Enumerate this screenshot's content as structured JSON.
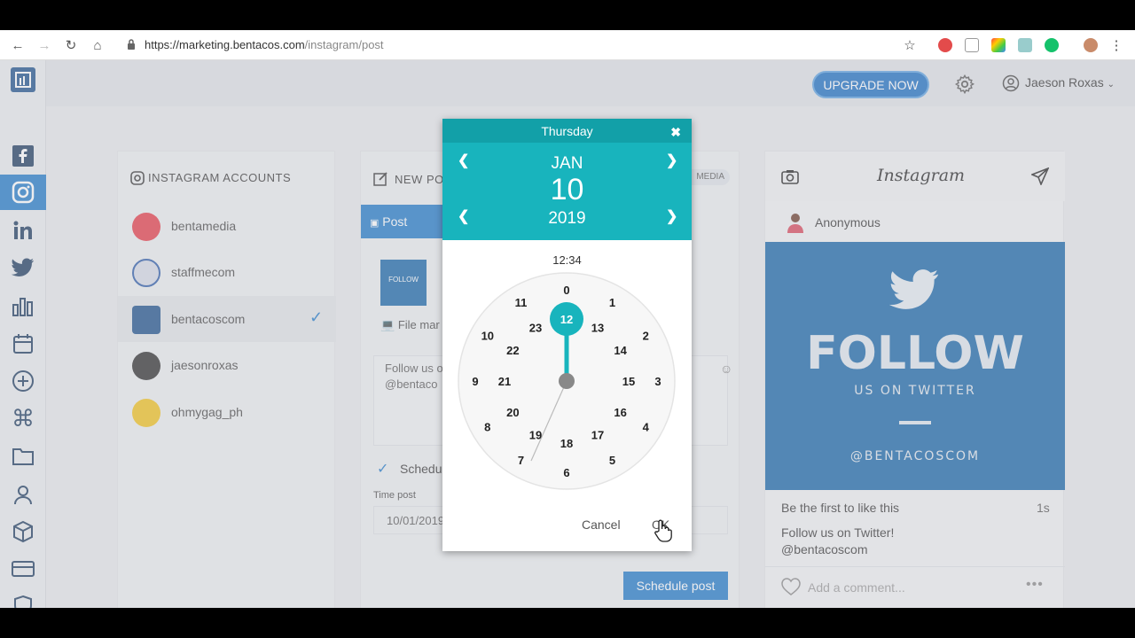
{
  "browser": {
    "url_host": "https://marketing.bentacos.com",
    "url_path": "/instagram/post"
  },
  "topbar": {
    "upgrade_label": "UPGRADE NOW",
    "user_name": "Jaeson Roxas"
  },
  "accounts": {
    "title": "INSTAGRAM ACCOUNTS",
    "items": [
      {
        "name": "bentamedia",
        "color": "#e53945"
      },
      {
        "name": "staffmecom",
        "color": "#2a5aa8"
      },
      {
        "name": "bentacoscom",
        "color": "#1b4f8a",
        "selected": true
      },
      {
        "name": "jaesonroxas",
        "color": "#333333"
      },
      {
        "name": "ohmygag_ph",
        "color": "#f2c21b"
      }
    ]
  },
  "newpost": {
    "title": "NEW PO",
    "badge": "MEDIA",
    "tab_post": "Post",
    "thumb_text": "FOLLOW",
    "file_manager": "File mar",
    "caption_line1": "Follow us o",
    "caption_line2": "@bentaco",
    "schedule_label": "Schedu",
    "time_label": "Time post",
    "time_value": "10/01/2019",
    "schedule_button": "Schedule post"
  },
  "preview": {
    "logo": "Instagram",
    "author": "Anonymous",
    "image_title": "FOLLOW",
    "image_subtitle": "US ON TWITTER",
    "image_handle": "@BENTACOSCOM",
    "likes_text": "Be the first to like this",
    "time_ago": "1s",
    "caption_line1": "Follow us on Twitter!",
    "caption_line2": "@bentacoscom",
    "comment_placeholder": "Add a comment..."
  },
  "picker": {
    "day": "Thursday",
    "month": "JAN",
    "date": "10",
    "year": "2019",
    "time": "12:34",
    "selected_hour": "12",
    "outer_hours": [
      "0",
      "1",
      "2",
      "3",
      "4",
      "5",
      "6",
      "7",
      "8",
      "9",
      "10",
      "11"
    ],
    "inner_hours": [
      "12",
      "13",
      "14",
      "15",
      "16",
      "17",
      "18",
      "19",
      "20",
      "21",
      "22",
      "23"
    ],
    "cancel_label": "Cancel",
    "ok_label": "OK",
    "accent": "#18b4bd"
  }
}
